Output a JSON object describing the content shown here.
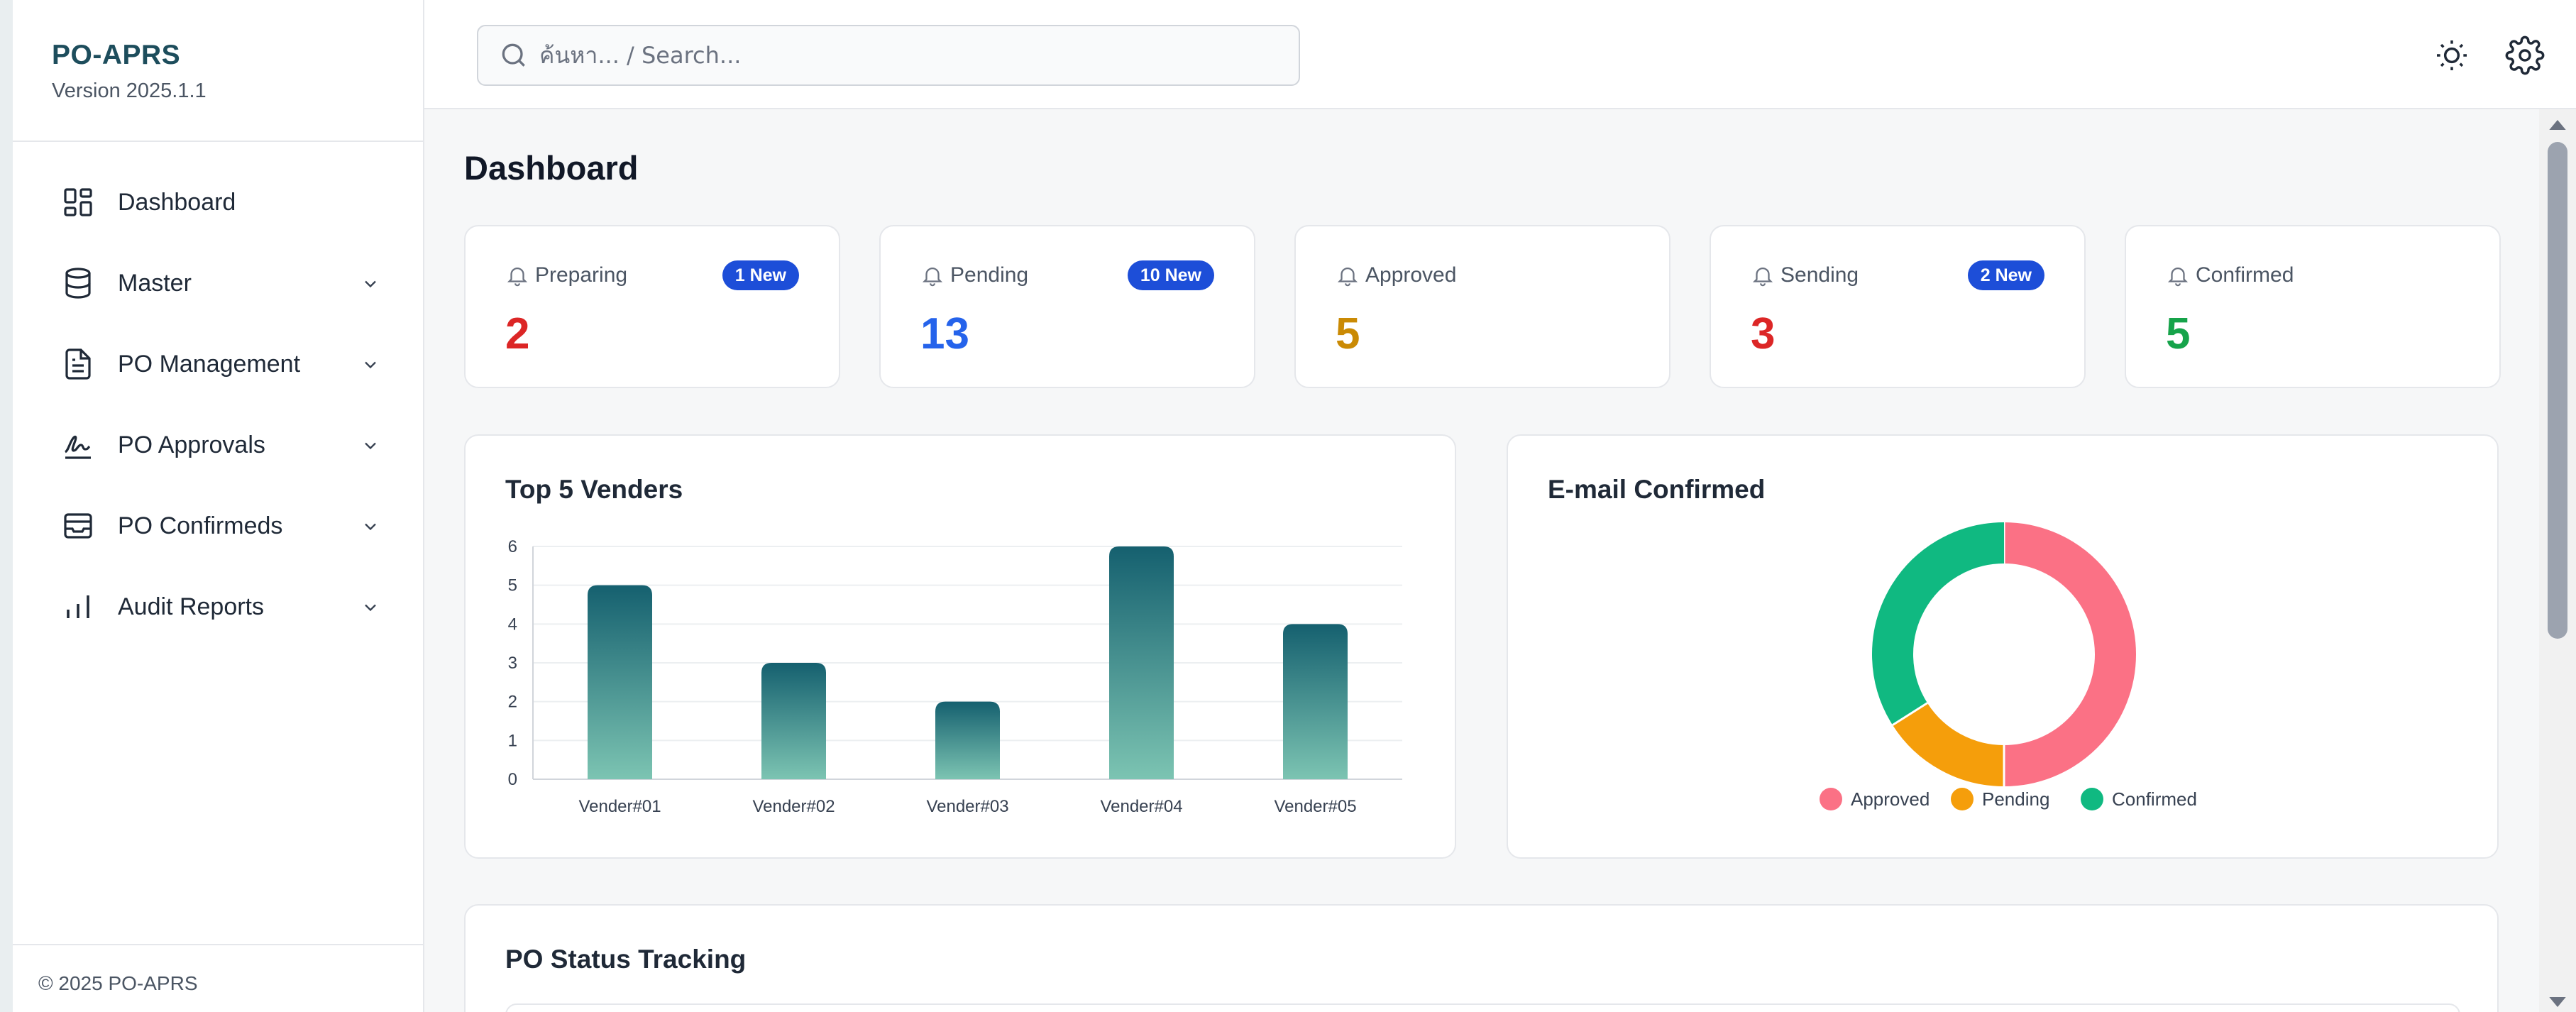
{
  "app": {
    "name": "PO-APRS",
    "version": "Version 2025.1.1",
    "copyright": "© 2025 PO-APRS"
  },
  "sidebar": {
    "items": [
      {
        "label": "Dashboard",
        "icon": "dashboard-icon",
        "expandable": false
      },
      {
        "label": "Master",
        "icon": "database-icon",
        "expandable": true
      },
      {
        "label": "PO Management",
        "icon": "document-icon",
        "expandable": true
      },
      {
        "label": "PO Approvals",
        "icon": "signature-icon",
        "expandable": true
      },
      {
        "label": "PO Confirmeds",
        "icon": "inbox-icon",
        "expandable": true
      },
      {
        "label": "Audit Reports",
        "icon": "bar-chart-icon",
        "expandable": true
      }
    ]
  },
  "search": {
    "placeholder": "ค้นหา... / Search..."
  },
  "header": {
    "theme_icon": "sun-icon",
    "settings_icon": "gear-icon"
  },
  "page": {
    "title": "Dashboard"
  },
  "stats": [
    {
      "label": "Preparing",
      "value": "2",
      "badge": "1 New",
      "color": "#dc2626"
    },
    {
      "label": "Pending",
      "value": "13",
      "badge": "10 New",
      "color": "#2563eb"
    },
    {
      "label": "Approved",
      "value": "5",
      "badge": "",
      "color": "#ca8a04"
    },
    {
      "label": "Sending",
      "value": "3",
      "badge": "2 New",
      "color": "#dc2626"
    },
    {
      "label": "Confirmed",
      "value": "5",
      "badge": "",
      "color": "#16a34a"
    }
  ],
  "panels": {
    "vendors_title": "Top 5 Venders",
    "email_title": "E-mail Confirmed",
    "tracking_title": "PO Status Tracking"
  },
  "chart_data": [
    {
      "type": "bar",
      "title": "Top 5 Venders",
      "categories": [
        "Vender#01",
        "Vender#02",
        "Vender#03",
        "Vender#04",
        "Vender#05"
      ],
      "values": [
        5,
        3,
        2,
        6,
        4
      ],
      "yticks": [
        "0",
        "1",
        "2",
        "3",
        "4",
        "5",
        "6"
      ],
      "ylim": [
        0,
        6
      ],
      "grid": true,
      "colors": {
        "top": "#15606f",
        "bottom": "#7cc4b2"
      }
    },
    {
      "type": "pie",
      "title": "E-mail Confirmed",
      "donut": true,
      "labels": [
        "Approved",
        "Pending",
        "Confirmed"
      ],
      "values": [
        50,
        16,
        34
      ],
      "colors": [
        "#fb7185",
        "#f59e0b",
        "#10b981"
      ],
      "legend": "bottom"
    }
  ]
}
